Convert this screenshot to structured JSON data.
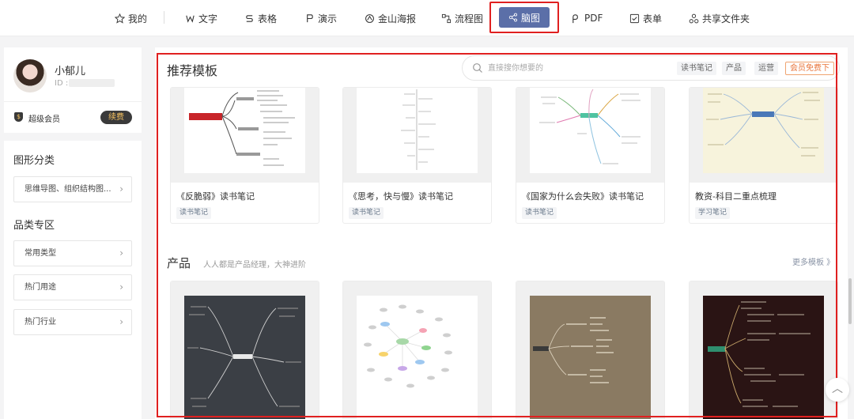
{
  "nav": {
    "items": [
      {
        "label": "我的",
        "icon": "star-icon"
      },
      {
        "label": "文字",
        "icon": "w-doc-icon"
      },
      {
        "label": "表格",
        "icon": "s-sheet-icon"
      },
      {
        "label": "演示",
        "icon": "p-slide-icon"
      },
      {
        "label": "金山海报",
        "icon": "poster-icon"
      },
      {
        "label": "流程图",
        "icon": "flowchart-icon"
      },
      {
        "label": "PDF",
        "icon": "pdf-icon"
      },
      {
        "label": "表单",
        "icon": "form-icon"
      },
      {
        "label": "共享文件夹",
        "icon": "share-folder-icon"
      }
    ],
    "active": {
      "label": "脑图",
      "icon": "mindmap-icon"
    }
  },
  "user": {
    "name": "小郁儿",
    "id_label": "ID :",
    "vip_label": "超级会员",
    "renew_label": "续费"
  },
  "categories": {
    "graphic_title": "图形分类",
    "graphic_item": "思维导图、组织结构图...",
    "zone_title": "品类专区",
    "zone_items": [
      "常用类型",
      "热门用途",
      "热门行业"
    ]
  },
  "main": {
    "title": "推荐模板",
    "search_placeholder": "直接搜你想要的",
    "search_tags": [
      "读书笔记",
      "产品",
      "运营"
    ],
    "vip_tag": "会员免费下",
    "recommended": [
      {
        "title": "《反脆弱》读书笔记",
        "tag": "读书笔记"
      },
      {
        "title": "《思考，快与慢》读书笔记",
        "tag": "读书笔记"
      },
      {
        "title": "《国家为什么会失败》读书笔记",
        "tag": "读书笔记"
      },
      {
        "title": "教资-科目二重点梳理",
        "tag": "学习笔记"
      }
    ],
    "product_section": {
      "title": "产品",
      "subtitle": "人人都是产品经理，大神进阶",
      "more": "更多模板 》"
    }
  },
  "colors": {
    "accent_active": "#5b6fa8",
    "highlight_red": "#e02020",
    "vip_orange": "#e8743a"
  }
}
